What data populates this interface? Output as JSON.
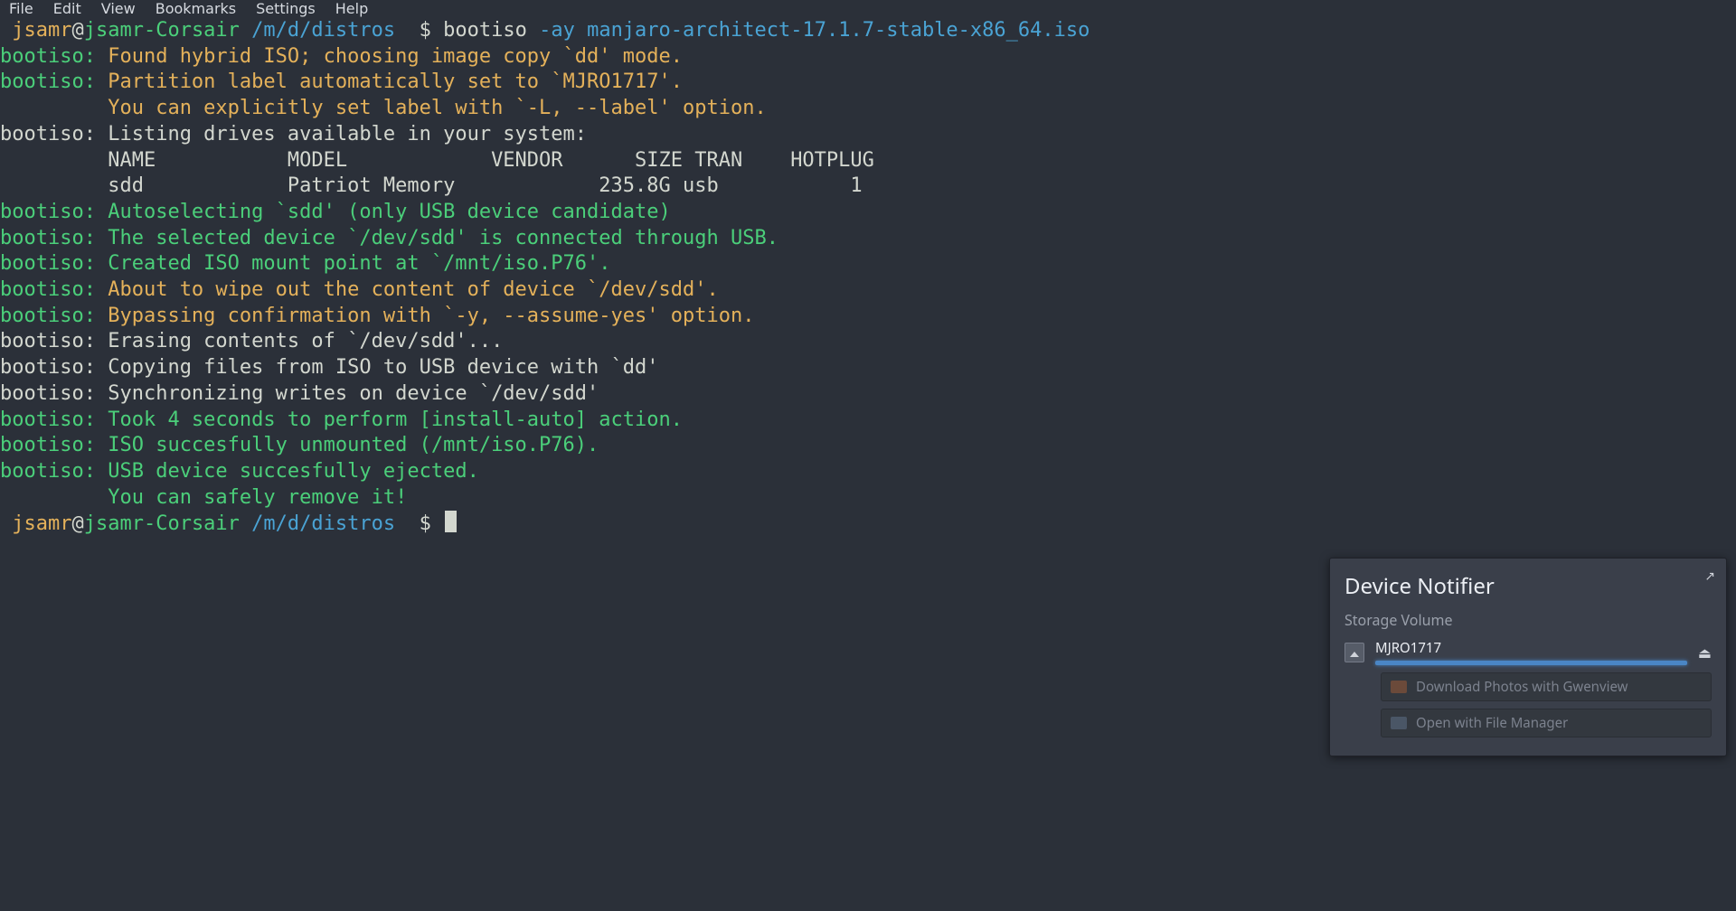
{
  "menu": [
    "File",
    "Edit",
    "View",
    "Bookmarks",
    "Settings",
    "Help"
  ],
  "prompt": {
    "user": "jsamr",
    "at": "@",
    "host": "jsamr-Corsair",
    "path": "/m/d/distros",
    "dollar": "$"
  },
  "command": {
    "bin": "bootiso",
    "flags": "-ay",
    "arg": "manjaro-architect-17.1.7-stable-x86_64.iso"
  },
  "table_header": "NAME           MODEL            VENDOR      SIZE TRAN    HOTPLUG",
  "table_row": "sdd            Patriot Memory            235.8G usb           1",
  "lines": [
    {
      "tag": "bootiso:",
      "tagc": "g",
      "msg": "Found hybrid ISO; choosing image copy `dd' mode.",
      "msgc": "y"
    },
    {
      "tag": "bootiso:",
      "tagc": "g",
      "msg": "Partition label automatically set to `MJRO1717'.",
      "msgc": "y"
    },
    {
      "tag": "",
      "tagc": "g",
      "msg": "You can explicitly set label with `-L, --label' option.",
      "msgc": "y",
      "indent": "         "
    },
    {
      "tag": "bootiso:",
      "tagc": "w",
      "msg": "Listing drives available in your system:",
      "msgc": "w"
    },
    {
      "raw_header": true
    },
    {
      "raw_row": true
    },
    {
      "tag": "bootiso:",
      "tagc": "g",
      "msg": "Autoselecting `sdd' (only USB device candidate)",
      "msgc": "g"
    },
    {
      "tag": "bootiso:",
      "tagc": "g",
      "msg": "The selected device `/dev/sdd' is connected through USB.",
      "msgc": "g"
    },
    {
      "tag": "bootiso:",
      "tagc": "g",
      "msg": "Created ISO mount point at `/mnt/iso.P76'.",
      "msgc": "g"
    },
    {
      "tag": "bootiso:",
      "tagc": "g",
      "msg": "About to wipe out the content of device `/dev/sdd'.",
      "msgc": "y"
    },
    {
      "tag": "bootiso:",
      "tagc": "g",
      "msg": "Bypassing confirmation with `-y, --assume-yes' option.",
      "msgc": "y"
    },
    {
      "tag": "bootiso:",
      "tagc": "w",
      "msg": "Erasing contents of `/dev/sdd'...",
      "msgc": "w"
    },
    {
      "tag": "bootiso:",
      "tagc": "w",
      "msg": "Copying files from ISO to USB device with `dd'",
      "msgc": "w"
    },
    {
      "tag": "bootiso:",
      "tagc": "w",
      "msg": "Synchronizing writes on device `/dev/sdd'",
      "msgc": "w"
    },
    {
      "tag": "bootiso:",
      "tagc": "g",
      "msg": "Took 4 seconds to perform [install-auto] action.",
      "msgc": "g"
    },
    {
      "tag": "bootiso:",
      "tagc": "g",
      "msg": "ISO succesfully unmounted (/mnt/iso.P76).",
      "msgc": "g"
    },
    {
      "tag": "bootiso:",
      "tagc": "g",
      "msg": "USB device succesfully ejected.",
      "msgc": "g"
    },
    {
      "tag": "",
      "tagc": "g",
      "msg": "You can safely remove it!",
      "msgc": "g",
      "indent": "         "
    }
  ],
  "notifier": {
    "title": "Device Notifier",
    "subtitle": "Storage Volume",
    "device": "MJRO1717",
    "action1": "Download Photos with Gwenview",
    "action2": "Open with File Manager"
  }
}
